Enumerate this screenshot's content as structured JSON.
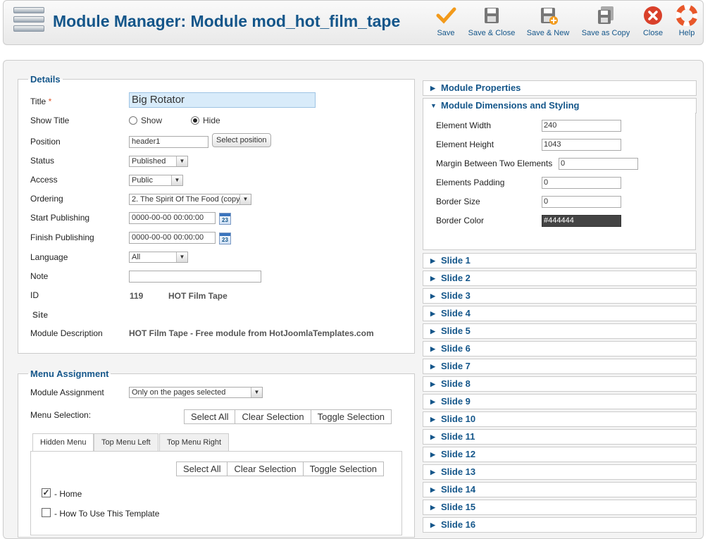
{
  "header": {
    "title": "Module Manager: Module mod_hot_film_tape"
  },
  "toolbar": {
    "save": "Save",
    "save_close": "Save & Close",
    "save_new": "Save & New",
    "save_copy": "Save as Copy",
    "close": "Close",
    "help": "Help"
  },
  "details": {
    "legend": "Details",
    "title_label": "Title",
    "required_mark": "*",
    "title_value": "Big Rotator",
    "show_title_label": "Show Title",
    "show_label": "Show",
    "hide_label": "Hide",
    "position_label": "Position",
    "position_value": "header1",
    "select_position": "Select position",
    "status_label": "Status",
    "status_value": "Published",
    "access_label": "Access",
    "access_value": "Public",
    "ordering_label": "Ordering",
    "ordering_value": "2. The Spirit Of The Food (copy)",
    "start_label": "Start Publishing",
    "start_value": "0000-00-00 00:00:00",
    "finish_label": "Finish Publishing",
    "finish_value": "0000-00-00 00:00:00",
    "calendar_text": "23",
    "language_label": "Language",
    "language_value": "All",
    "note_label": "Note",
    "note_value": "",
    "id_label": "ID",
    "id_value": "119",
    "id_name": "HOT Film Tape",
    "site_label": "Site",
    "desc_label": "Module Description",
    "desc_value": "HOT Film Tape - Free module from HotJoomlaTemplates.com"
  },
  "menu": {
    "legend": "Menu Assignment",
    "assign_label": "Module Assignment",
    "assign_value": "Only on the pages selected",
    "selection_label": "Menu Selection:",
    "select_all": "Select All",
    "clear_selection": "Clear Selection",
    "toggle_selection": "Toggle Selection",
    "tabs": [
      "Hidden Menu",
      "Top Menu Left",
      "Top Menu Right"
    ],
    "items": [
      {
        "label": "- Home",
        "checked": true
      },
      {
        "label": "- How To Use This Template",
        "checked": false
      }
    ]
  },
  "panes": {
    "properties": "Module Properties",
    "dimensions": "Module Dimensions and Styling",
    "fields": [
      {
        "label": "Element Width",
        "value": "240"
      },
      {
        "label": "Element Height",
        "value": "1043"
      },
      {
        "label": "Margin Between Two Elements",
        "value": "0"
      },
      {
        "label": "Elements Padding",
        "value": "0"
      },
      {
        "label": "Border Size",
        "value": "0"
      },
      {
        "label": "Border Color",
        "value": "#444444"
      }
    ],
    "slides": [
      "Slide 1",
      "Slide 2",
      "Slide 3",
      "Slide 4",
      "Slide 5",
      "Slide 6",
      "Slide 7",
      "Slide 8",
      "Slide 9",
      "Slide 10",
      "Slide 11",
      "Slide 12",
      "Slide 13",
      "Slide 14",
      "Slide 15",
      "Slide 16"
    ]
  },
  "colors": {
    "accent": "#14568a",
    "border_color_swatch": "#444444",
    "close_red": "#d9402a",
    "save_orange": "#f29a1b"
  }
}
